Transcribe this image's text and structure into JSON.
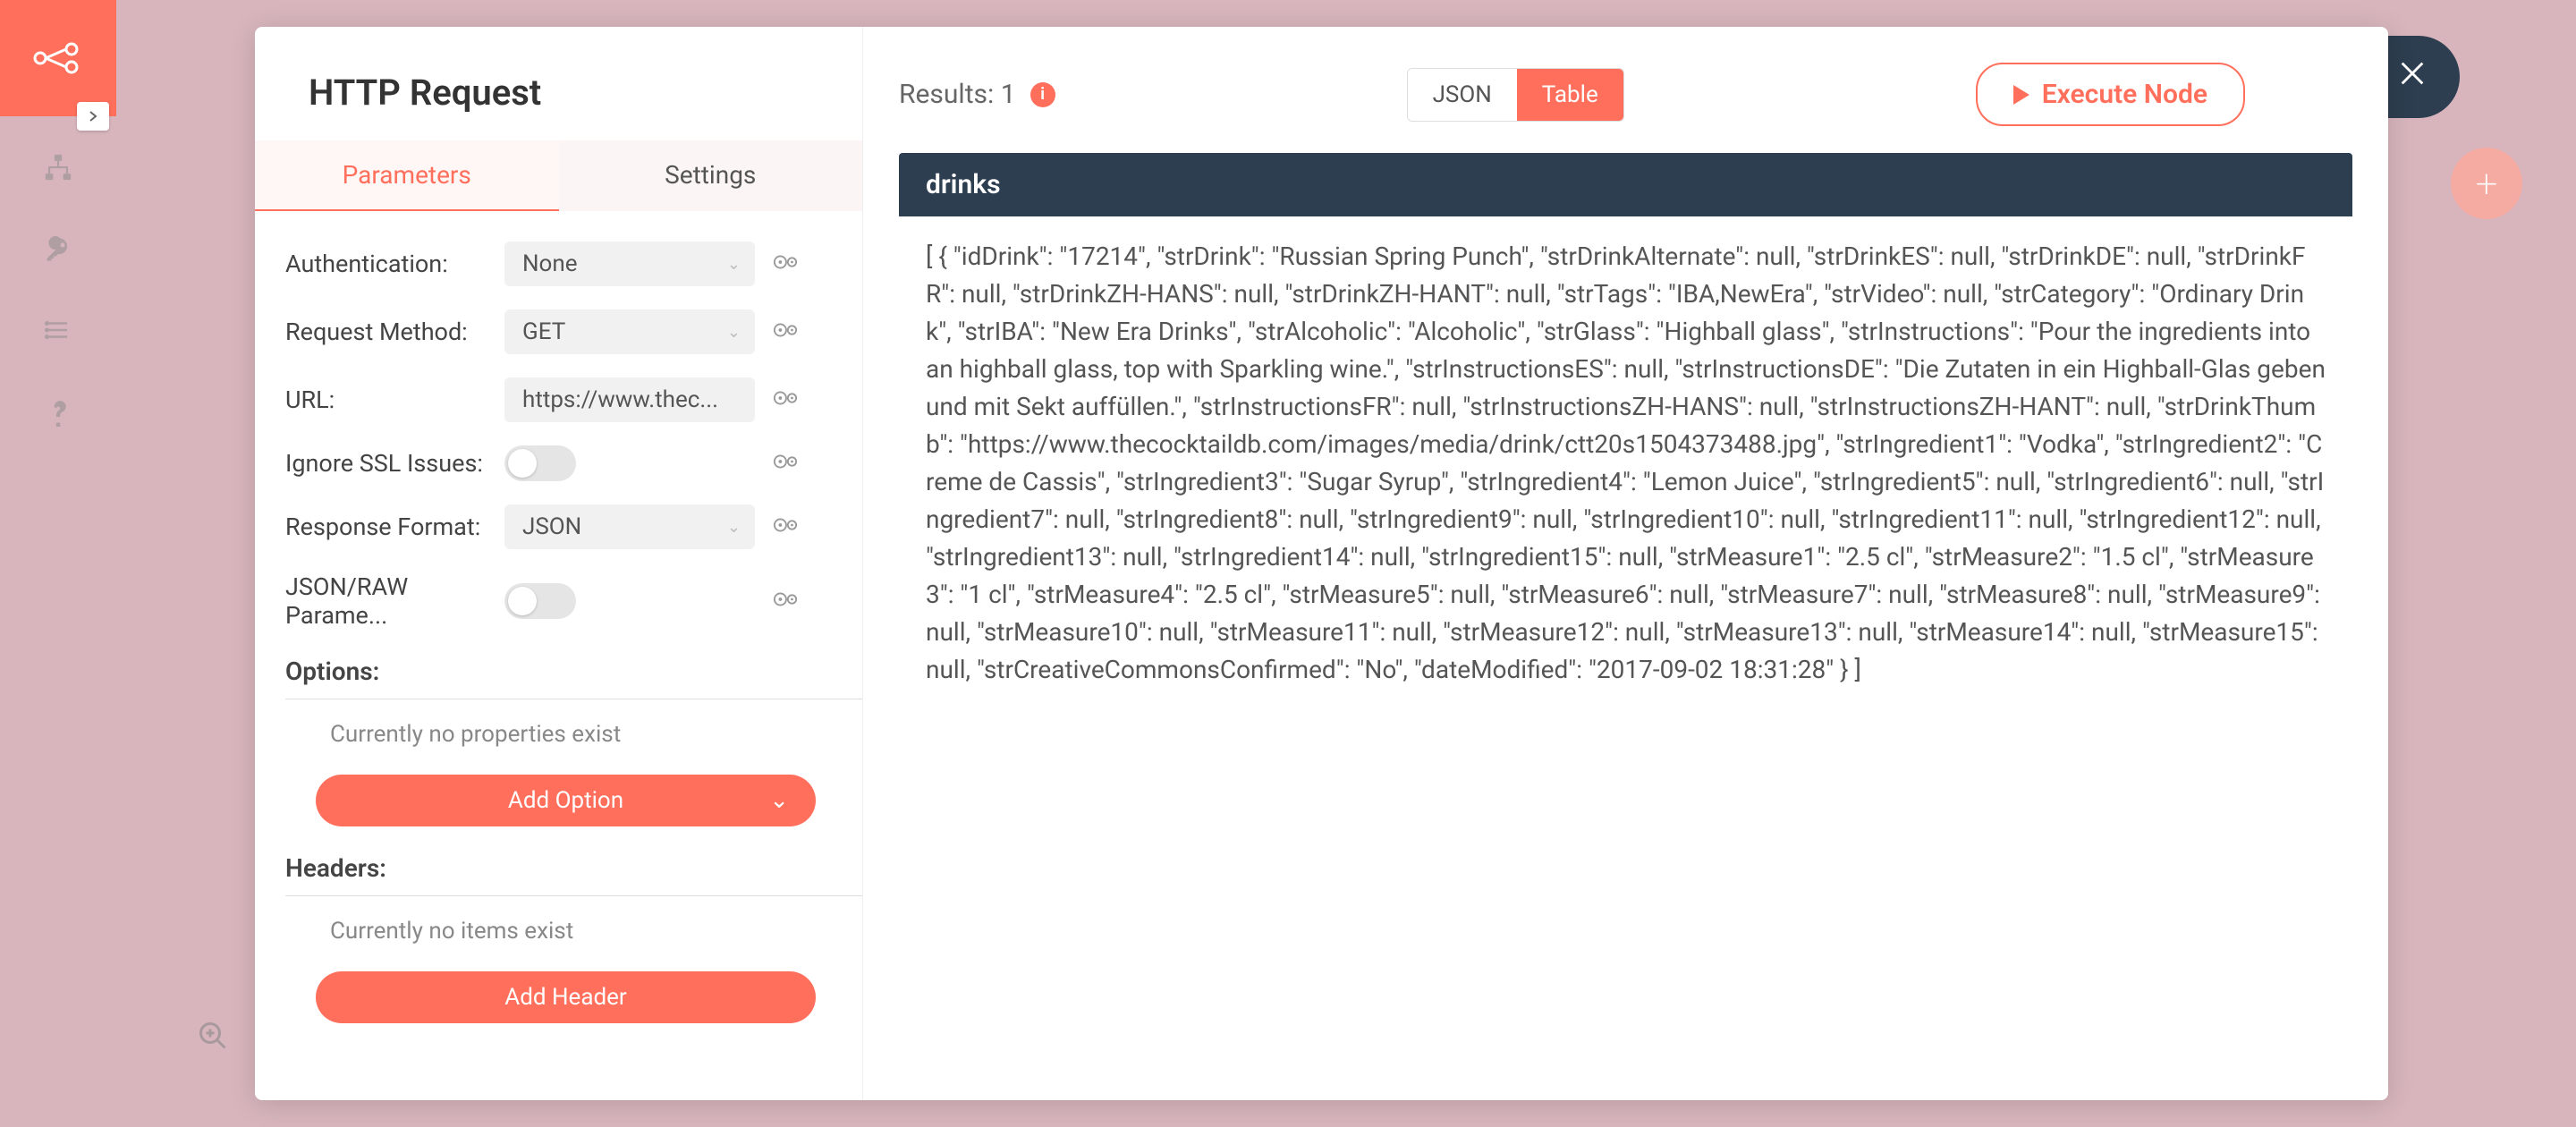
{
  "sidebar": {
    "icons": [
      "workflow-icon",
      "credentials-icon",
      "executions-icon",
      "help-icon"
    ]
  },
  "modal": {
    "title": "HTTP Request",
    "tabs": {
      "parameters": "Parameters",
      "settings": "Settings",
      "active": "parameters"
    },
    "params": {
      "authentication": {
        "label": "Authentication:",
        "value": "None"
      },
      "method": {
        "label": "Request Method:",
        "value": "GET"
      },
      "url": {
        "label": "URL:",
        "value": "https://www.thec..."
      },
      "ssl": {
        "label": "Ignore SSL Issues:",
        "value": false
      },
      "respFormat": {
        "label": "Response Format:",
        "value": "JSON"
      },
      "jsonRaw": {
        "label": "JSON/RAW Parame...",
        "value": false
      }
    },
    "options": {
      "label": "Options:",
      "empty": "Currently no properties exist",
      "addLabel": "Add Option"
    },
    "headers": {
      "label": "Headers:",
      "empty": "Currently no items exist",
      "addLabel": "Add Header"
    }
  },
  "results": {
    "label": "Results: 1",
    "view": {
      "json": "JSON",
      "table": "Table",
      "active": "table"
    },
    "execute": "Execute Node",
    "column": "drinks",
    "json_text": "[ { \"idDrink\": \"17214\", \"strDrink\": \"Russian Spring Punch\", \"strDrinkAlternate\": null, \"strDrinkES\": null, \"strDrinkDE\": null, \"strDrinkFR\": null, \"strDrinkZH-HANS\": null, \"strDrinkZH-HANT\": null, \"strTags\": \"IBA,NewEra\", \"strVideo\": null, \"strCategory\": \"Ordinary Drink\", \"strIBA\": \"New Era Drinks\", \"strAlcoholic\": \"Alcoholic\", \"strGlass\": \"Highball glass\", \"strInstructions\": \"Pour the ingredients into an highball glass, top with Sparkling wine.\", \"strInstructionsES\": null, \"strInstructionsDE\": \"Die Zutaten in ein Highball-Glas geben und mit Sekt auffüllen.\", \"strInstructionsFR\": null, \"strInstructionsZH-HANS\": null, \"strInstructionsZH-HANT\": null, \"strDrinkThumb\": \"https://www.thecocktaildb.com/images/media/drink/ctt20s1504373488.jpg\", \"strIngredient1\": \"Vodka\", \"strIngredient2\": \"Creme de Cassis\", \"strIngredient3\": \"Sugar Syrup\", \"strIngredient4\": \"Lemon Juice\", \"strIngredient5\": null, \"strIngredient6\": null, \"strIngredient7\": null, \"strIngredient8\": null, \"strIngredient9\": null, \"strIngredient10\": null, \"strIngredient11\": null, \"strIngredient12\": null, \"strIngredient13\": null, \"strIngredient14\": null, \"strIngredient15\": null, \"strMeasure1\": \"2.5 cl\", \"strMeasure2\": \"1.5 cl\", \"strMeasure3\": \"1 cl\", \"strMeasure4\": \"2.5 cl\", \"strMeasure5\": null, \"strMeasure6\": null, \"strMeasure7\": null, \"strMeasure8\": null, \"strMeasure9\": null, \"strMeasure10\": null, \"strMeasure11\": null, \"strMeasure12\": null, \"strMeasure13\": null, \"strMeasure14\": null, \"strMeasure15\": null, \"strCreativeCommonsConfirmed\": \"No\", \"dateModified\": \"2017-09-02 18:31:28\" } ]"
  }
}
